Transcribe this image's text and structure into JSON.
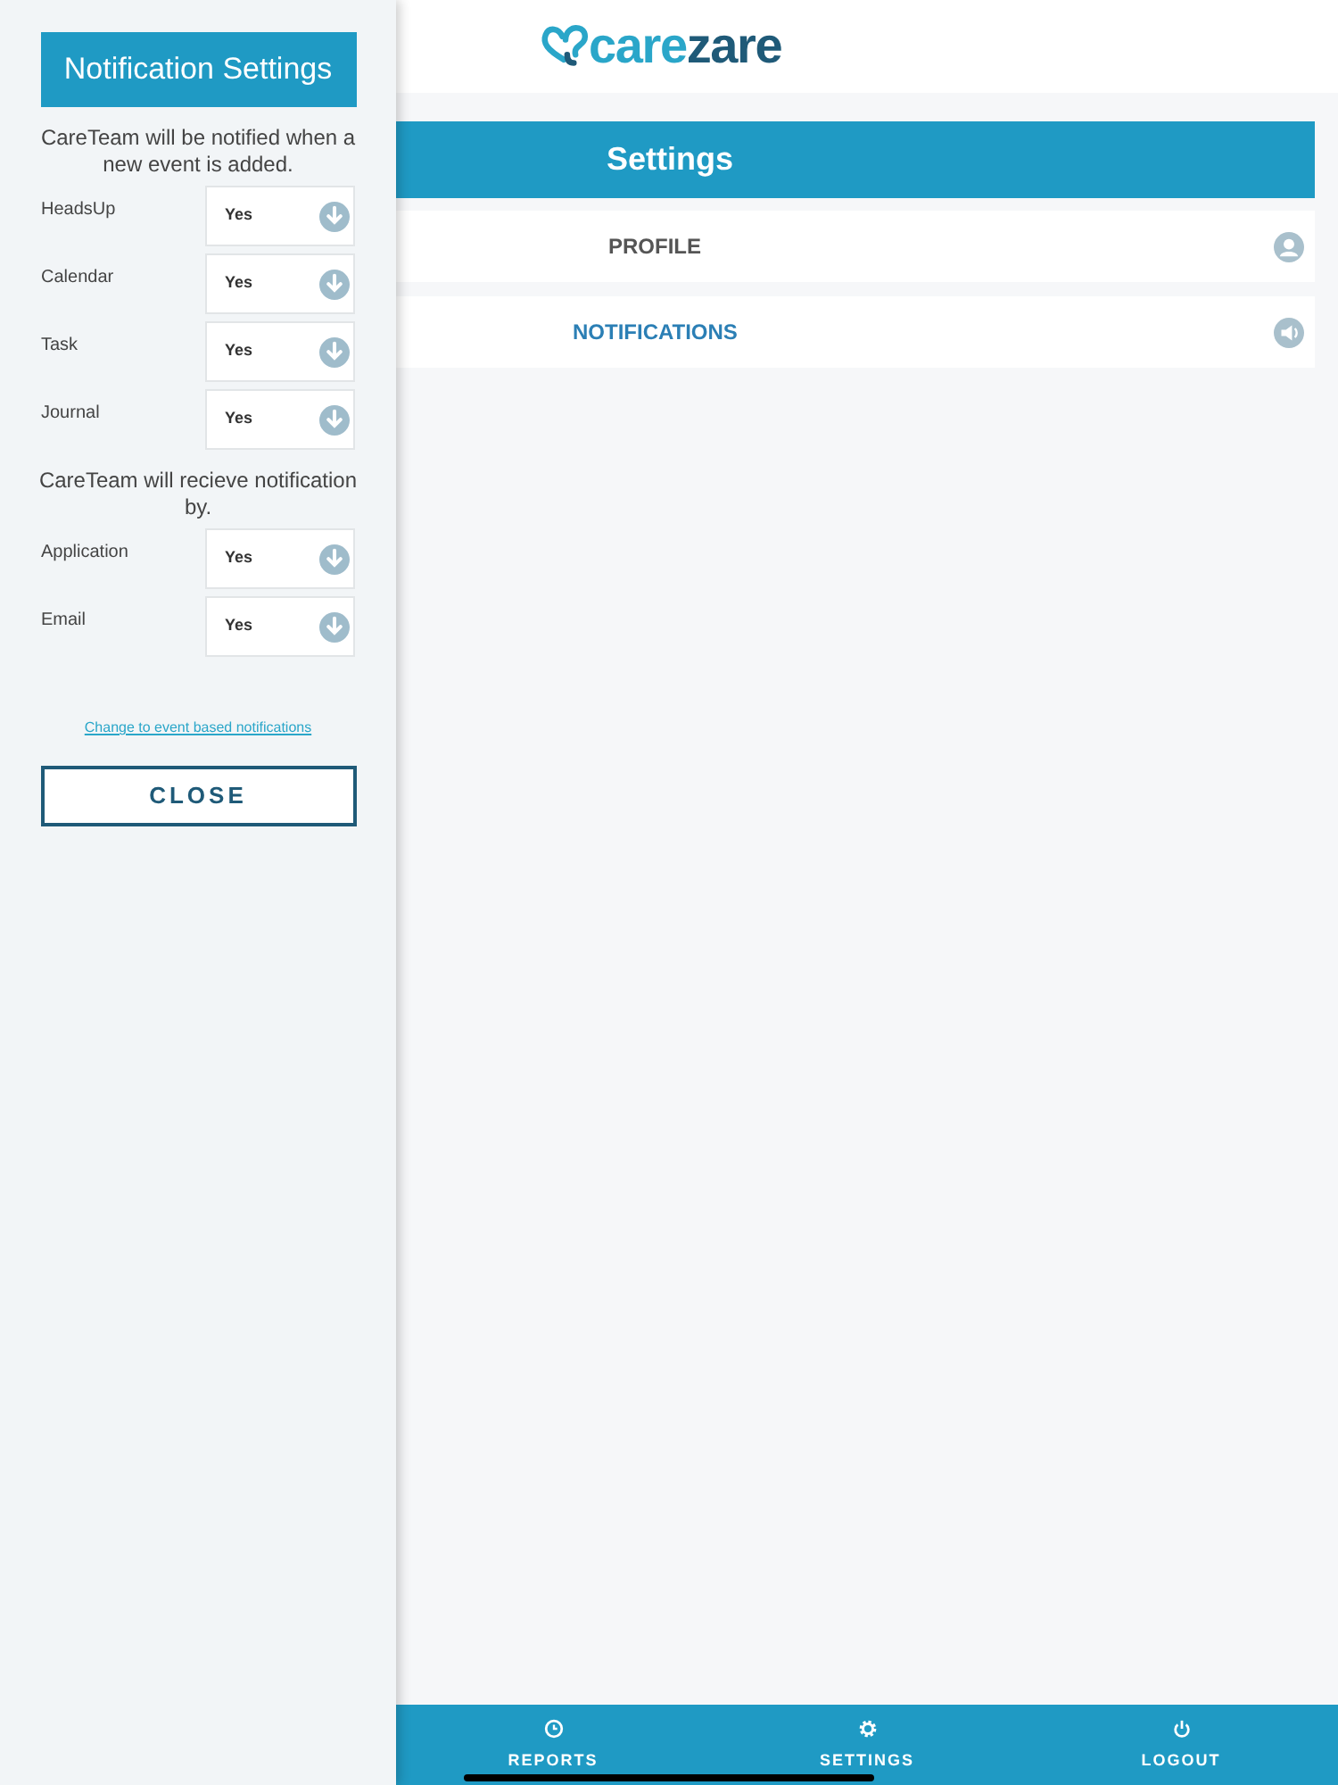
{
  "panel": {
    "title": "Notification Settings",
    "intro": "CareTeam will be notified when a new event is added.",
    "events": [
      {
        "label": "HeadsUp",
        "value": "Yes"
      },
      {
        "label": "Calendar",
        "value": "Yes"
      },
      {
        "label": "Task",
        "value": "Yes"
      },
      {
        "label": "Journal",
        "value": "Yes"
      }
    ],
    "channels_intro": "CareTeam will recieve notification by.",
    "channels": [
      {
        "label": "Application",
        "value": "Yes"
      },
      {
        "label": "Email",
        "value": "Yes"
      }
    ],
    "link": "Change to event based notifications",
    "close": "CLOSE"
  },
  "logo": {
    "parts": [
      "care",
      "zare"
    ]
  },
  "settings": {
    "title": "Settings",
    "items": [
      {
        "label": "PROFILE",
        "kind": "profile",
        "selected": false
      },
      {
        "label": "NOTIFICATIONS",
        "kind": "notifications",
        "selected": true
      }
    ]
  },
  "nav": [
    {
      "label": "REPORTS",
      "kind": "reports"
    },
    {
      "label": "SETTINGS",
      "kind": "settings"
    },
    {
      "label": "LOGOUT",
      "kind": "logout"
    }
  ]
}
